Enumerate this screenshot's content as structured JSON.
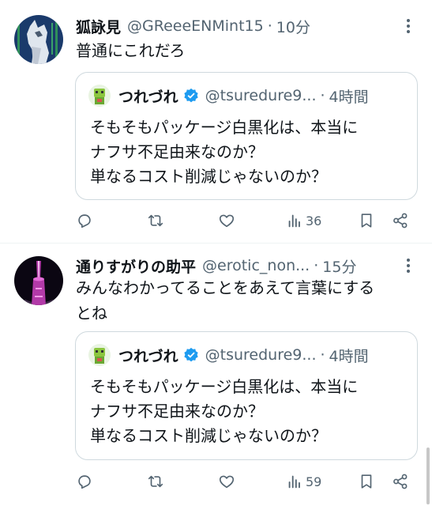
{
  "tweets": [
    {
      "name": "狐詠見",
      "handle": "@GReeeENMint15",
      "time": "10分",
      "text": [
        "普通にこれだろ"
      ],
      "quote": {
        "name": "つれづれ",
        "handle": "@tsuredure9...",
        "time": "4時間",
        "lines": [
          "そもそもパッケージ白黒化は、本当に",
          "ナフサ不足由来なのか？",
          "単なるコスト削減じゃないのか？"
        ]
      },
      "views": "36"
    },
    {
      "name": "通りすがりの助平",
      "handle": "@erotic_non...",
      "time": "15分",
      "text": [
        "みんなわかってることをあえて言葉にする",
        "とね"
      ],
      "quote": {
        "name": "つれづれ",
        "handle": "@tsuredure9...",
        "time": "4時間",
        "lines": [
          "そもそもパッケージ白黒化は、本当に",
          "ナフサ不足由来なのか？",
          "単なるコスト削減じゃないのか？"
        ]
      },
      "views": "59"
    }
  ],
  "separator": "·",
  "colors": {
    "text": "#0f1419",
    "secondary": "#536471",
    "border": "#cfd9de",
    "verified": "#1d9bf0"
  },
  "icons": [
    "more-icon",
    "verified-icon",
    "reply-icon",
    "retweet-icon",
    "like-icon",
    "views-icon",
    "bookmark-icon",
    "share-icon"
  ]
}
